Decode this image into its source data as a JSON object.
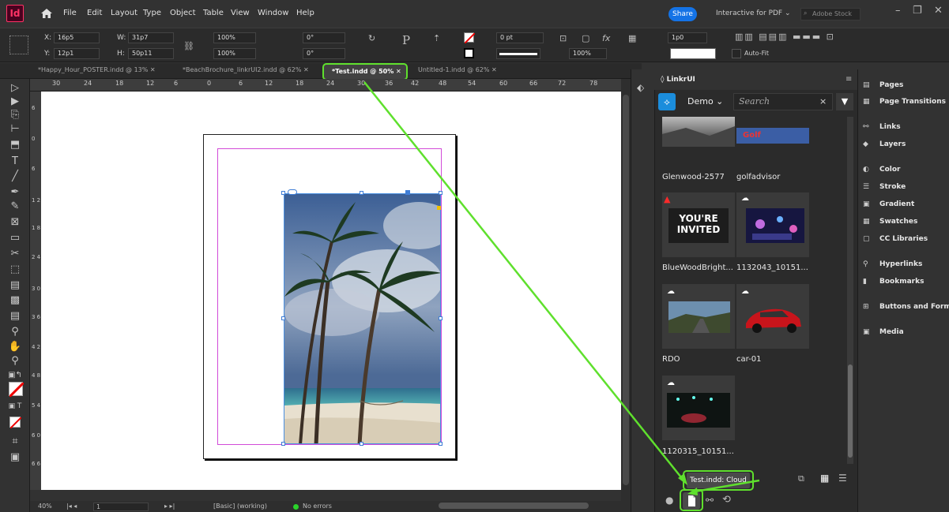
{
  "app": {
    "logo_text": "Id"
  },
  "menu": [
    "File",
    "Edit",
    "Layout",
    "Type",
    "Object",
    "Table",
    "View",
    "Window",
    "Help"
  ],
  "topbar": {
    "share_label": "Share",
    "workspace_label": "Interactive for PDF",
    "stock_search_placeholder": "Adobe Stock"
  },
  "control": {
    "x_label": "X:",
    "x_value": "16p5",
    "y_label": "Y:",
    "y_value": "12p1",
    "w_label": "W:",
    "w_value": "31p7",
    "h_label": "H:",
    "h_value": "50p11",
    "scale_x": "100%",
    "scale_y": "100%",
    "rotate": "0°",
    "shear": "0°",
    "stroke_weight": "0 pt",
    "opacity": "100%",
    "gap": "1p0",
    "autofit_label": "Auto-Fit"
  },
  "tabs": [
    {
      "label": "*Happy_Hour_POSTER.indd @ 13%"
    },
    {
      "label": "*BeachBrochure_linkrUI2.indd @ 62%"
    },
    {
      "label": "*Test.indd @ 50%",
      "active": true
    },
    {
      "label": "Untitled-1.indd @ 62%"
    }
  ],
  "ruler_h": [
    "30",
    "24",
    "18",
    "12",
    "6",
    "0",
    "6",
    "12",
    "18",
    "24",
    "30",
    "36",
    "42",
    "48",
    "54",
    "60",
    "66",
    "72",
    "78"
  ],
  "ruler_v": [
    "6",
    "0",
    "6",
    "1 2",
    "1 8",
    "2 4",
    "3 0",
    "3 6",
    "4 2",
    "4 8",
    "5 4",
    "6 0",
    "6 6"
  ],
  "status": {
    "zoom": "40%",
    "page": "1",
    "preflight_profile": "[Basic] (working)",
    "errors": "No errors"
  },
  "linkr": {
    "panel_title": "LinkrUI",
    "project": "Demo",
    "search_placeholder": "Search",
    "assets": [
      {
        "label": "Glenwood-2577",
        "cloud": false,
        "warn": false
      },
      {
        "label": "golfadvisor",
        "cloud": false,
        "warn": false,
        "logo_text": "Golf"
      },
      {
        "label": "BlueWoodBright...",
        "cloud": false,
        "warn": true,
        "image_text": "YOU'RE INVITED"
      },
      {
        "label": "1132043_10151...",
        "cloud": true,
        "warn": false
      },
      {
        "label": "RDO",
        "cloud": true,
        "warn": false
      },
      {
        "label": "car-01",
        "cloud": true,
        "warn": false
      },
      {
        "label": "1120315_10151...",
        "cloud": true,
        "warn": false
      }
    ],
    "tooltip": "Test.indd: Cloud"
  },
  "dock": [
    "Pages",
    "Page Transitions",
    "Links",
    "Layers",
    "Color",
    "Stroke",
    "Gradient",
    "Swatches",
    "CC Libraries",
    "Hyperlinks",
    "Bookmarks",
    "Buttons and Forms",
    "Media"
  ],
  "colors": {
    "highlight": "#5fe02d",
    "accent": "#1473e6",
    "frame": "#4a8fe0",
    "margin": "#d24bd8"
  }
}
